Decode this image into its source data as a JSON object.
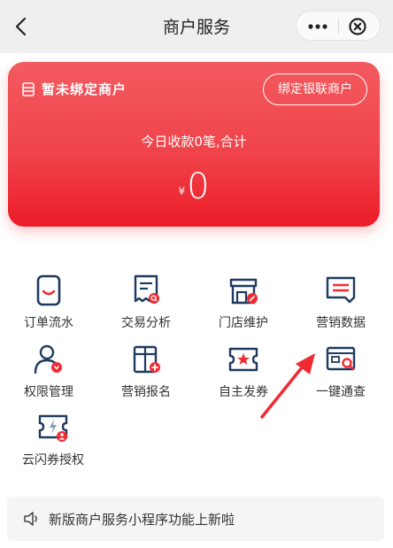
{
  "nav": {
    "title": "商户服务"
  },
  "card": {
    "status": "暂未绑定商户",
    "bind_button": "绑定银联商户",
    "summary": "今日收款0笔,合计",
    "currency": "¥",
    "amount": "0"
  },
  "grid": [
    {
      "label": "订单流水",
      "icon": "order-flow-icon"
    },
    {
      "label": "交易分析",
      "icon": "transaction-analysis-icon"
    },
    {
      "label": "门店维护",
      "icon": "store-maintenance-icon"
    },
    {
      "label": "营销数据",
      "icon": "marketing-data-icon"
    },
    {
      "label": "权限管理",
      "icon": "permission-management-icon"
    },
    {
      "label": "营销报名",
      "icon": "marketing-signup-icon"
    },
    {
      "label": "自主发券",
      "icon": "coupon-issue-icon"
    },
    {
      "label": "一键通查",
      "icon": "one-click-query-icon"
    },
    {
      "label": "云闪券授权",
      "icon": "cloud-coupon-auth-icon"
    }
  ],
  "notice": {
    "text": "新版商户服务小程序功能上新啦"
  },
  "colors": {
    "accent": "#ef2b33",
    "icon_dark": "#1f3a5f",
    "nav_bg": "#efefef"
  }
}
